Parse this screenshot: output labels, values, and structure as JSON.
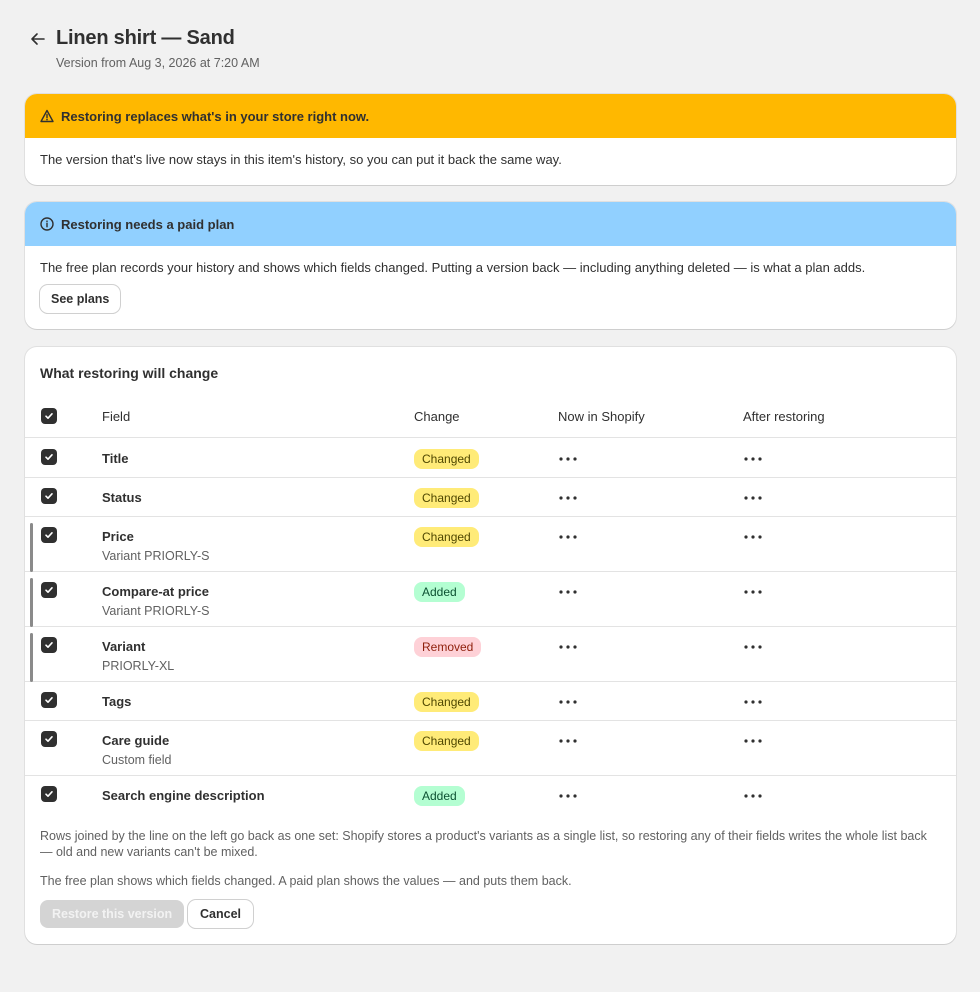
{
  "header": {
    "title": "Linen shirt — Sand",
    "subtitle": "Version from Aug 3, 2026 at 7:20 AM"
  },
  "warning": {
    "title": "Restoring replaces what's in your store right now.",
    "body": "The version that's live now stays in this item's history, so you can put it back the same way.",
    "icon": "warning-icon",
    "color": "#ffb800"
  },
  "info": {
    "title": "Restoring needs a paid plan",
    "body": "The free plan records your history and shows which fields changed. Putting a version back — including anything deleted — is what a plan adds.",
    "button": "See plans",
    "icon": "info-icon",
    "color": "#91d0ff"
  },
  "card": {
    "title": "What restoring will change",
    "columns": [
      "Field",
      "Change",
      "Now in Shopify",
      "After restoring"
    ],
    "rows": [
      {
        "field": "Title",
        "sub": "",
        "change": "Changed",
        "kind": "changed",
        "linked": false
      },
      {
        "field": "Status",
        "sub": "",
        "change": "Changed",
        "kind": "changed",
        "linked": false
      },
      {
        "field": "Price",
        "sub": "Variant PRIORLY-S",
        "change": "Changed",
        "kind": "changed",
        "linked": true
      },
      {
        "field": "Compare-at price",
        "sub": "Variant PRIORLY-S",
        "change": "Added",
        "kind": "added",
        "linked": true
      },
      {
        "field": "Variant",
        "sub": "PRIORLY-XL",
        "change": "Removed",
        "kind": "removed",
        "linked": true
      },
      {
        "field": "Tags",
        "sub": "",
        "change": "Changed",
        "kind": "changed",
        "linked": false
      },
      {
        "field": "Care guide",
        "sub": "Custom field",
        "change": "Changed",
        "kind": "changed",
        "linked": false
      },
      {
        "field": "Search engine description",
        "sub": "",
        "change": "Added",
        "kind": "added",
        "linked": false
      }
    ],
    "note1": "Rows joined by the line on the left go back as one set: Shopify stores a product's variants as a single list, so restoring any of their fields writes the whole list back — old and new variants can't be mixed.",
    "note2": "The free plan shows which fields changed. A paid plan shows the values — and puts them back.",
    "restore_button": "Restore this version",
    "cancel_button": "Cancel"
  }
}
